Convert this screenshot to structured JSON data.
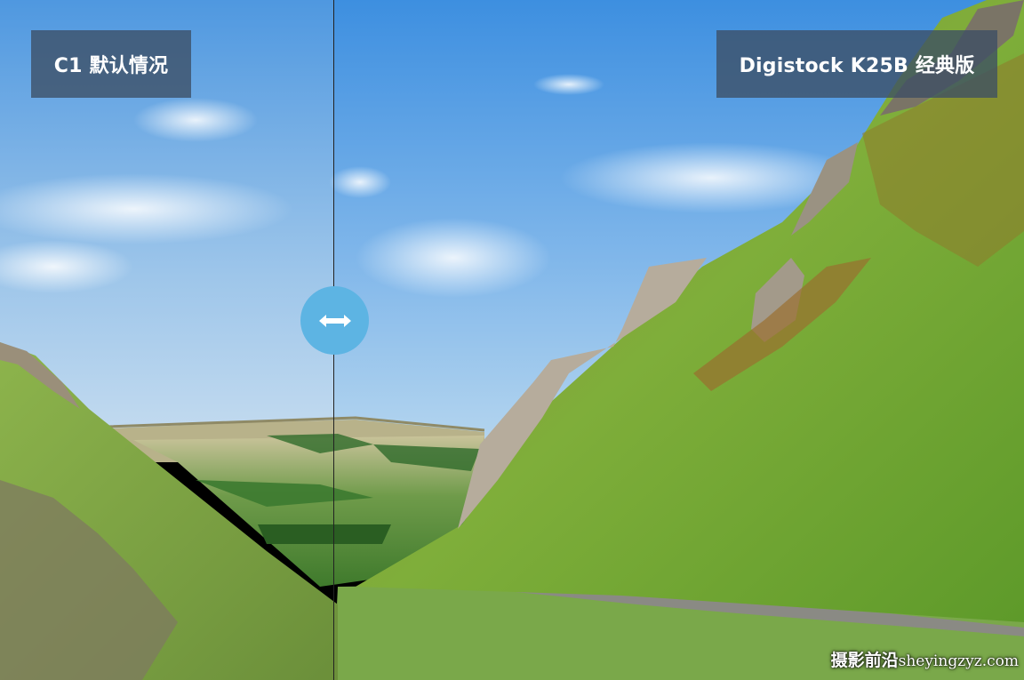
{
  "labels": {
    "left": "C1 默认情况",
    "right": "Digistock K25B 经典版"
  },
  "slider": {
    "handle_icon": "double-arrow-horizontal-icon",
    "color": "#5db4e3"
  },
  "watermark": {
    "text_cn": "摄影前沿",
    "text_url": "sheyingzyz.com"
  }
}
